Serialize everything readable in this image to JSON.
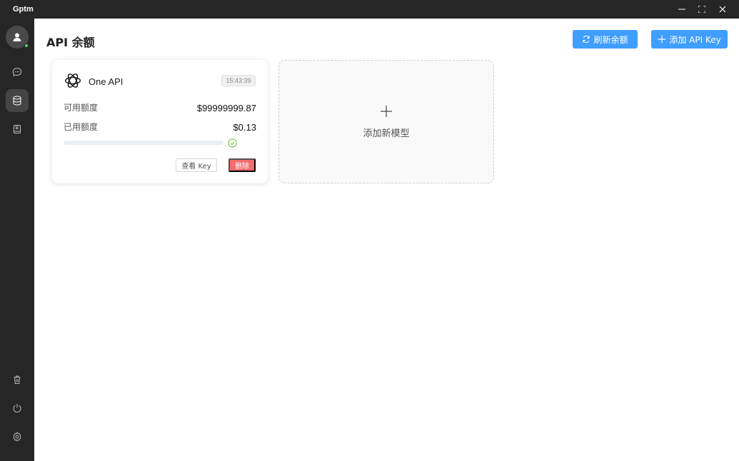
{
  "window": {
    "title": "Gptm",
    "controls": [
      "minimize-icon",
      "maximize-icon",
      "close-icon"
    ]
  },
  "sidebar": {
    "avatar_status": "online",
    "top_items": [
      {
        "icon": "chat-icon",
        "active": false
      },
      {
        "icon": "database-icon",
        "active": true
      },
      {
        "icon": "book-icon",
        "active": false
      }
    ],
    "bottom_items": [
      {
        "icon": "trash-icon"
      },
      {
        "icon": "power-icon"
      },
      {
        "icon": "gear-icon"
      }
    ]
  },
  "header": {
    "title": "API 余额",
    "refresh_button": "刷新余额",
    "add_button": "添加 API Key"
  },
  "cards": [
    {
      "logo": "openai-logo-icon",
      "name": "One API",
      "time": "15:43:39",
      "available_label": "可用额度",
      "available_value": "$99999999.87",
      "used_label": "已用额度",
      "used_value": "$0.13",
      "usage_fraction": 0,
      "status_icon": "check-circle-icon",
      "view_key_button": "查看 Key",
      "delete_button": "删除"
    }
  ],
  "add_model_card": {
    "icon": "plus-icon",
    "label": "添加新模型"
  },
  "colors": {
    "primary": "#409eff",
    "danger": "#f56c6c",
    "success": "#67c23a",
    "sidebar_bg": "#262626",
    "online": "#4cd964"
  }
}
